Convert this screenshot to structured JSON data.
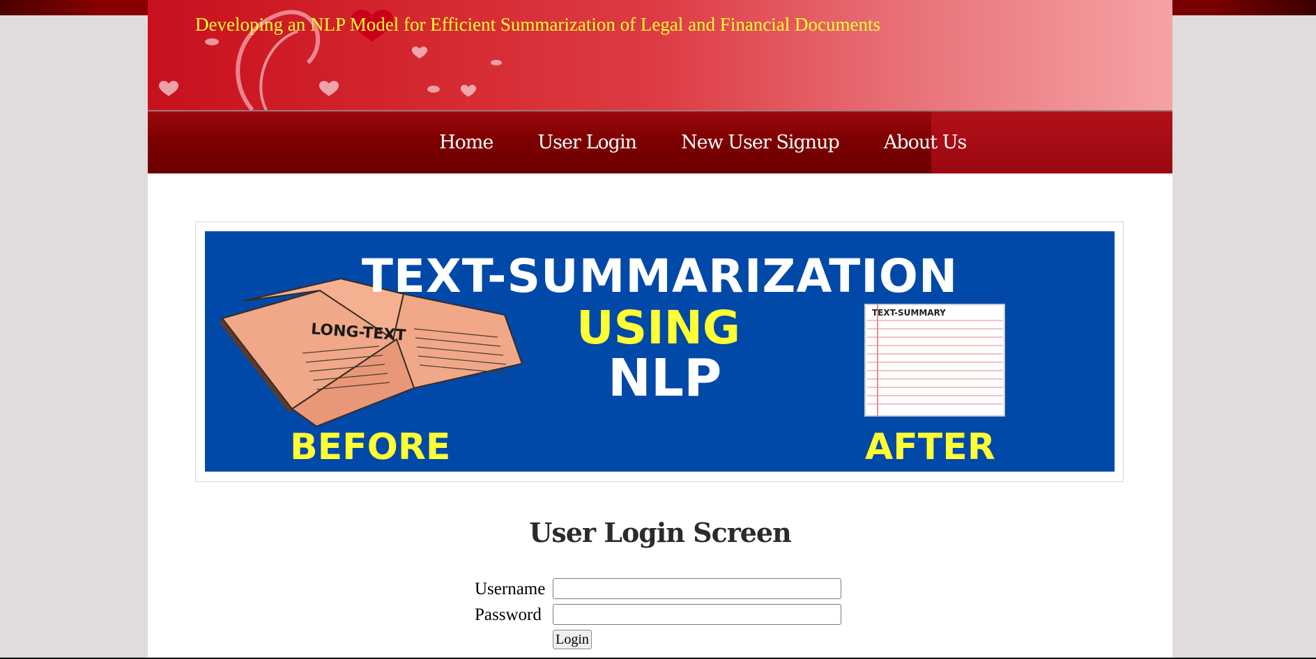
{
  "header": {
    "title": "Developing an NLP Model for Efficient Summarization of Legal and Financial Documents"
  },
  "nav": {
    "items": [
      "Home",
      "User Login",
      "New User Signup",
      "About Us"
    ]
  },
  "banner": {
    "title": "TEXT-SUMMARIZATION",
    "using": "USING",
    "nlp": "NLP",
    "book_label": "LONG-TEXT",
    "paper_label": "TEXT-SUMMARY",
    "before": "BEFORE",
    "after": "AFTER"
  },
  "login": {
    "heading": "User Login Screen",
    "username_label": "Username",
    "password_label": "Password",
    "username_value": "",
    "password_value": "",
    "submit_label": "Login"
  },
  "colors": {
    "title_yellow": "#ffff33",
    "nav_red": "#7e0000",
    "banner_blue": "#0049a8"
  }
}
